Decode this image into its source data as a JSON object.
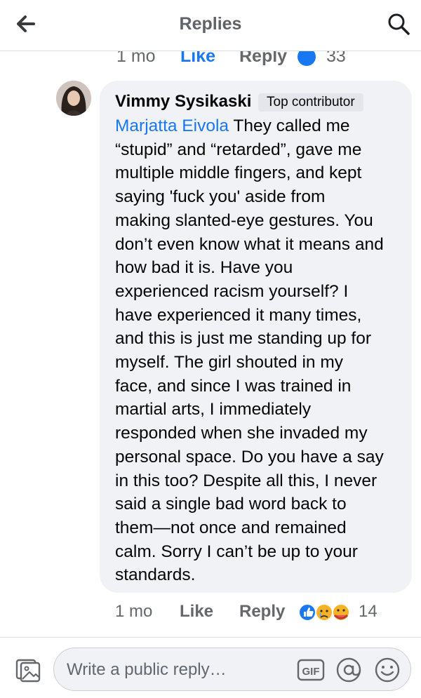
{
  "header": {
    "title": "Replies"
  },
  "previous_comment_actions": {
    "time": "1 mo",
    "like_label": "Like",
    "reply_label": "Reply",
    "reaction_count": "33"
  },
  "comment": {
    "author": "Vimmy Sysikaski",
    "badge": "Top contributor",
    "mention": "Marjatta Eivola",
    "lines": [
      " They called me",
      "“stupid” and “retarded”, gave me",
      "multiple middle fingers, and kept",
      "saying 'fuck you' aside from",
      "making slanted-eye gestures. You",
      "don’t even know what it means and",
      "how bad it is. Have you",
      "experienced racism yourself? I",
      "have experienced it many times,",
      "and this is just me standing up for",
      "myself. The girl shouted in my",
      "face, and since I was trained in",
      "martial arts, I immediately",
      "responded when she invaded my",
      "personal space. Do you have a say",
      "in this too? Despite all this, I never",
      "said a single bad word back to",
      "them—not once and remained",
      "calm. Sorry I can’t be up to your",
      "standards."
    ],
    "time": "1 mo",
    "like_label": "Like",
    "reply_label": "Reply",
    "reaction_count": "14",
    "reactions": [
      "like-icon",
      "sad-icon",
      "care-icon"
    ]
  },
  "composer": {
    "placeholder": "Write a public reply…",
    "gif_label": "GIF"
  },
  "colors": {
    "accent": "#1877f2",
    "bubble": "#f0f2f5",
    "secondary_text": "#65676b"
  }
}
